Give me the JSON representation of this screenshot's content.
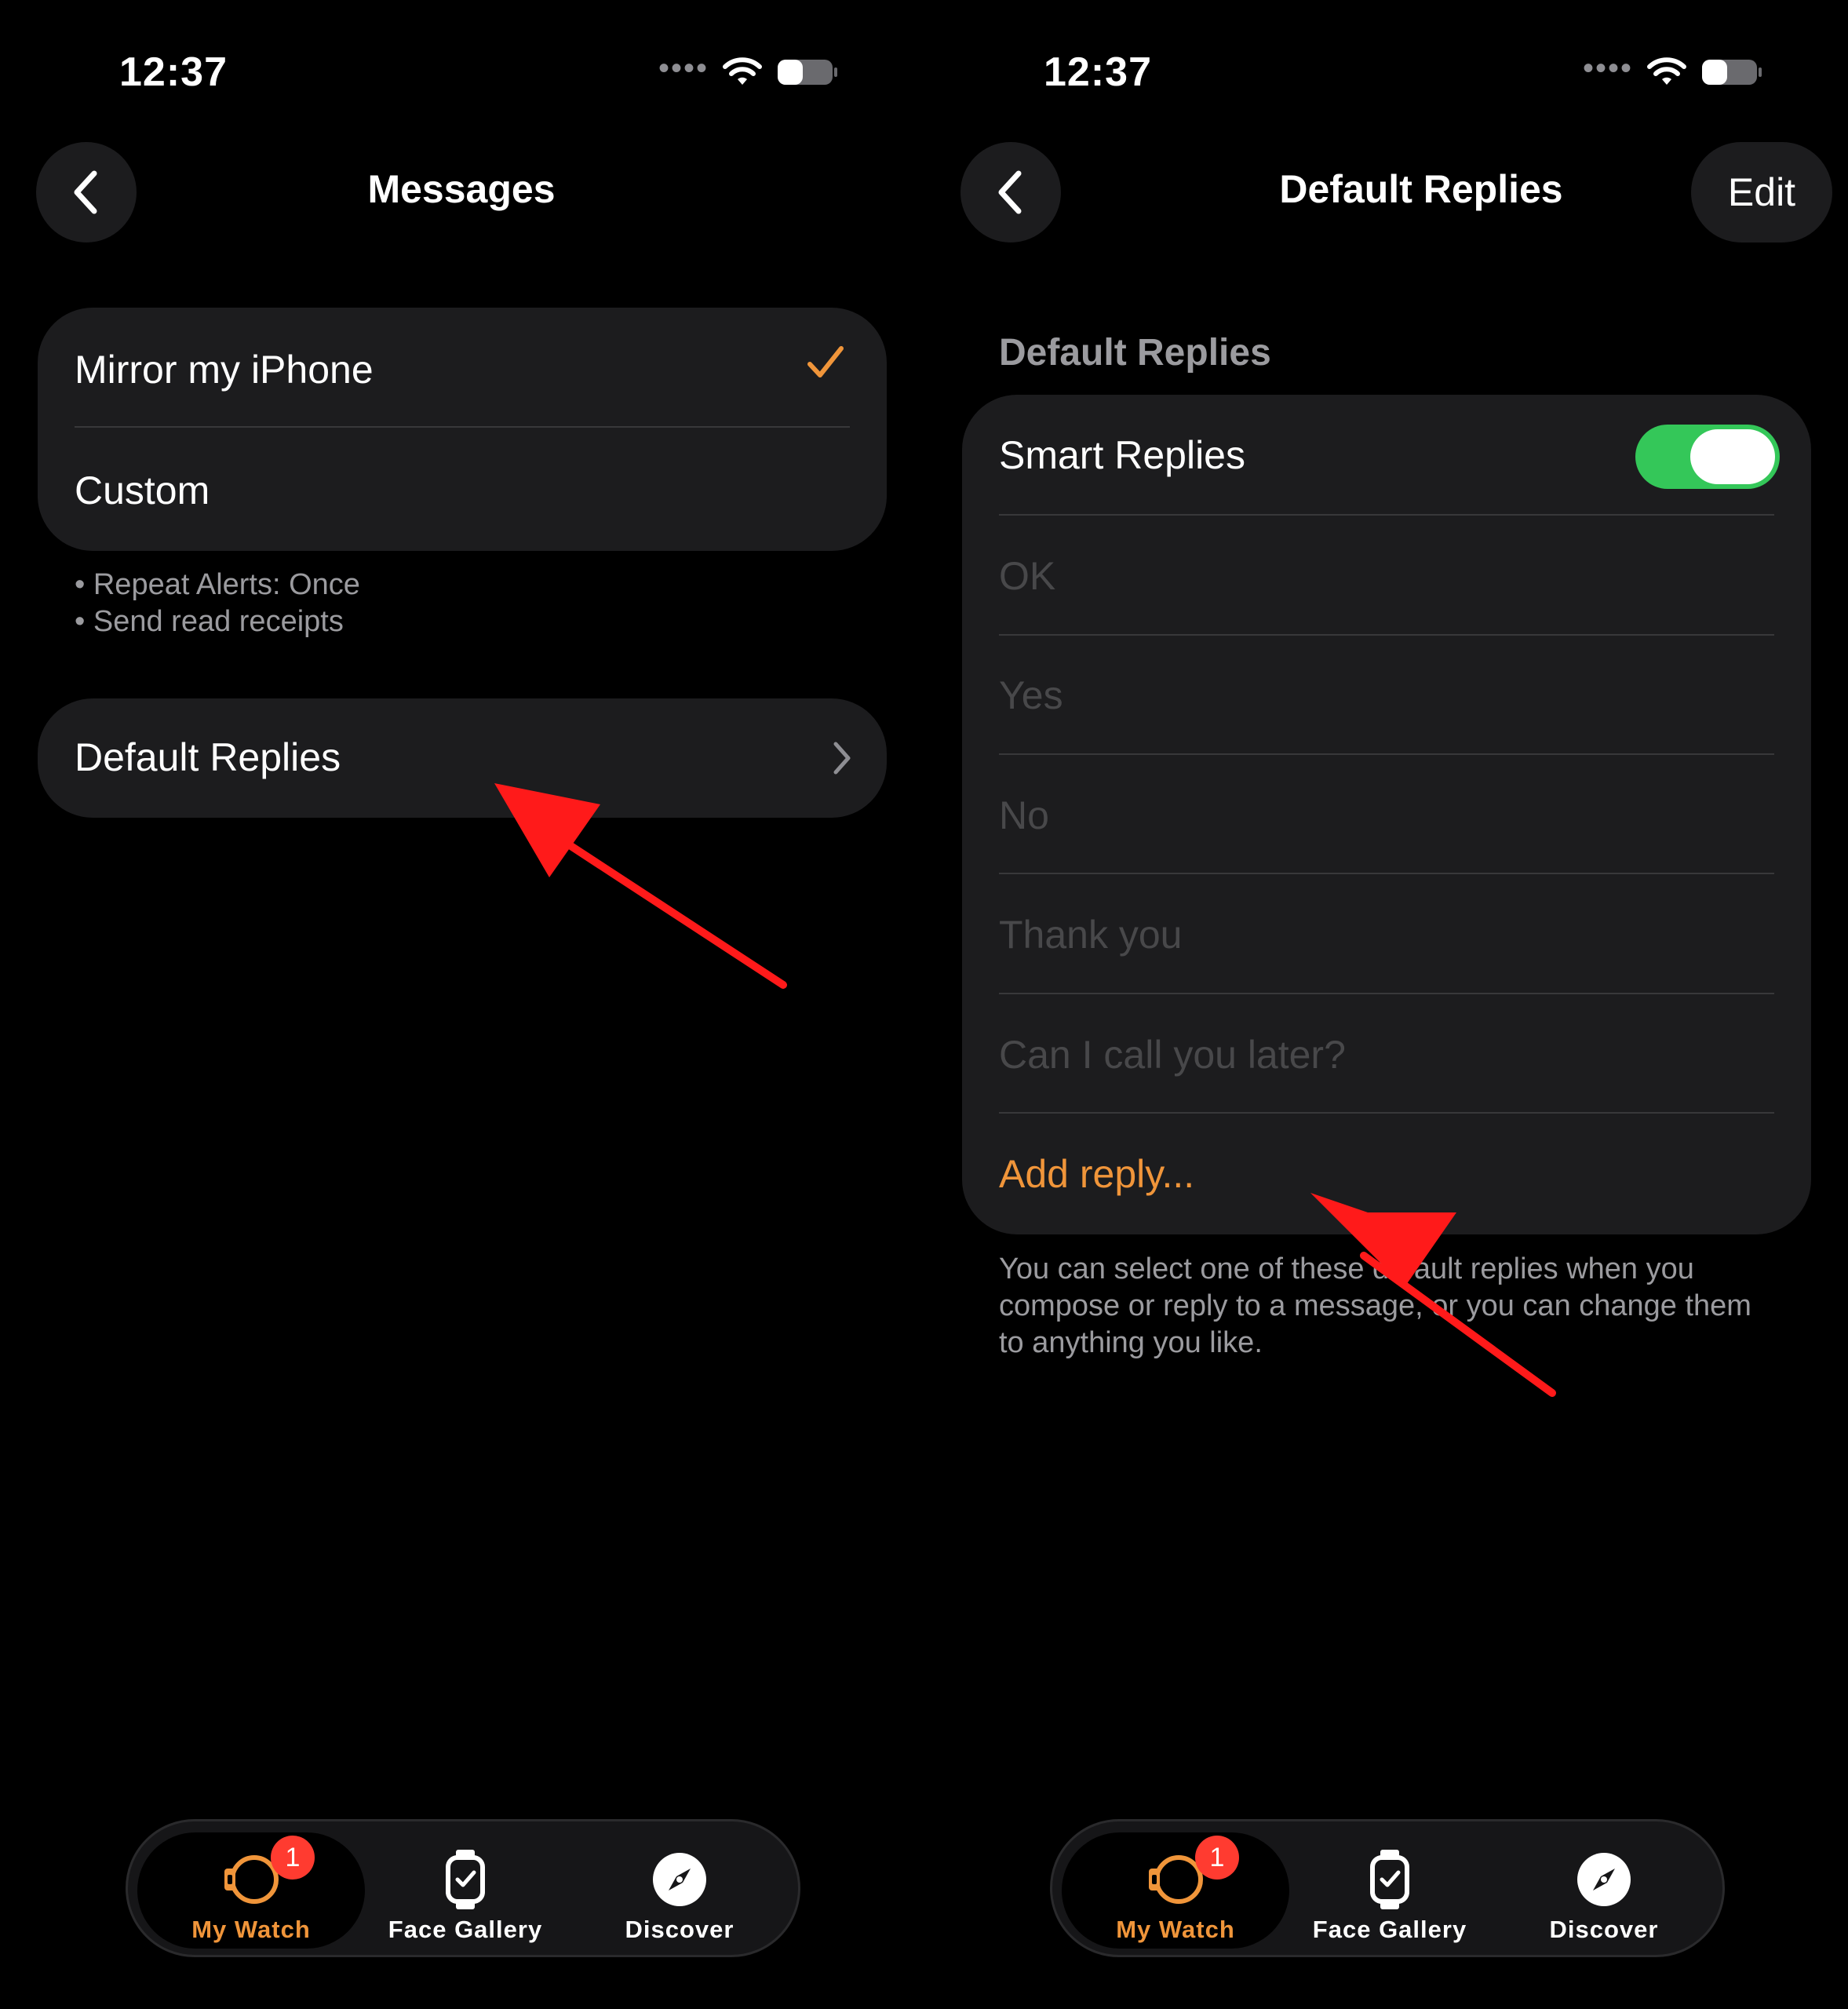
{
  "status_bar": {
    "time": "12:37"
  },
  "colors": {
    "accent": "#f0953a",
    "toggle_on": "#34c759",
    "badge": "#ff3b30",
    "annotation_arrow": "#ff1a1a"
  },
  "left_screen": {
    "nav_title": "Messages",
    "options": [
      {
        "label": "Mirror my iPhone",
        "selected": true
      },
      {
        "label": "Custom",
        "selected": false
      }
    ],
    "footnotes": [
      "• Repeat Alerts: Once",
      "• Send read receipts"
    ],
    "default_replies_row": {
      "label": "Default Replies"
    }
  },
  "right_screen": {
    "nav_title": "Default Replies",
    "edit_label": "Edit",
    "section_header": "Default Replies",
    "smart_replies": {
      "label": "Smart Replies",
      "enabled": true
    },
    "replies": [
      "OK",
      "Yes",
      "No",
      "Thank you",
      "Can I call you later?"
    ],
    "add_reply_label": "Add reply...",
    "footer_text": "You can select one of these default replies when you compose or reply to a message, or you can change them to anything you like."
  },
  "tab_bar": {
    "tabs": [
      {
        "label": "My Watch",
        "icon": "watch-icon",
        "active": true,
        "badge": "1"
      },
      {
        "label": "Face Gallery",
        "icon": "face-gallery-icon",
        "active": false
      },
      {
        "label": "Discover",
        "icon": "compass-icon",
        "active": false
      }
    ]
  }
}
